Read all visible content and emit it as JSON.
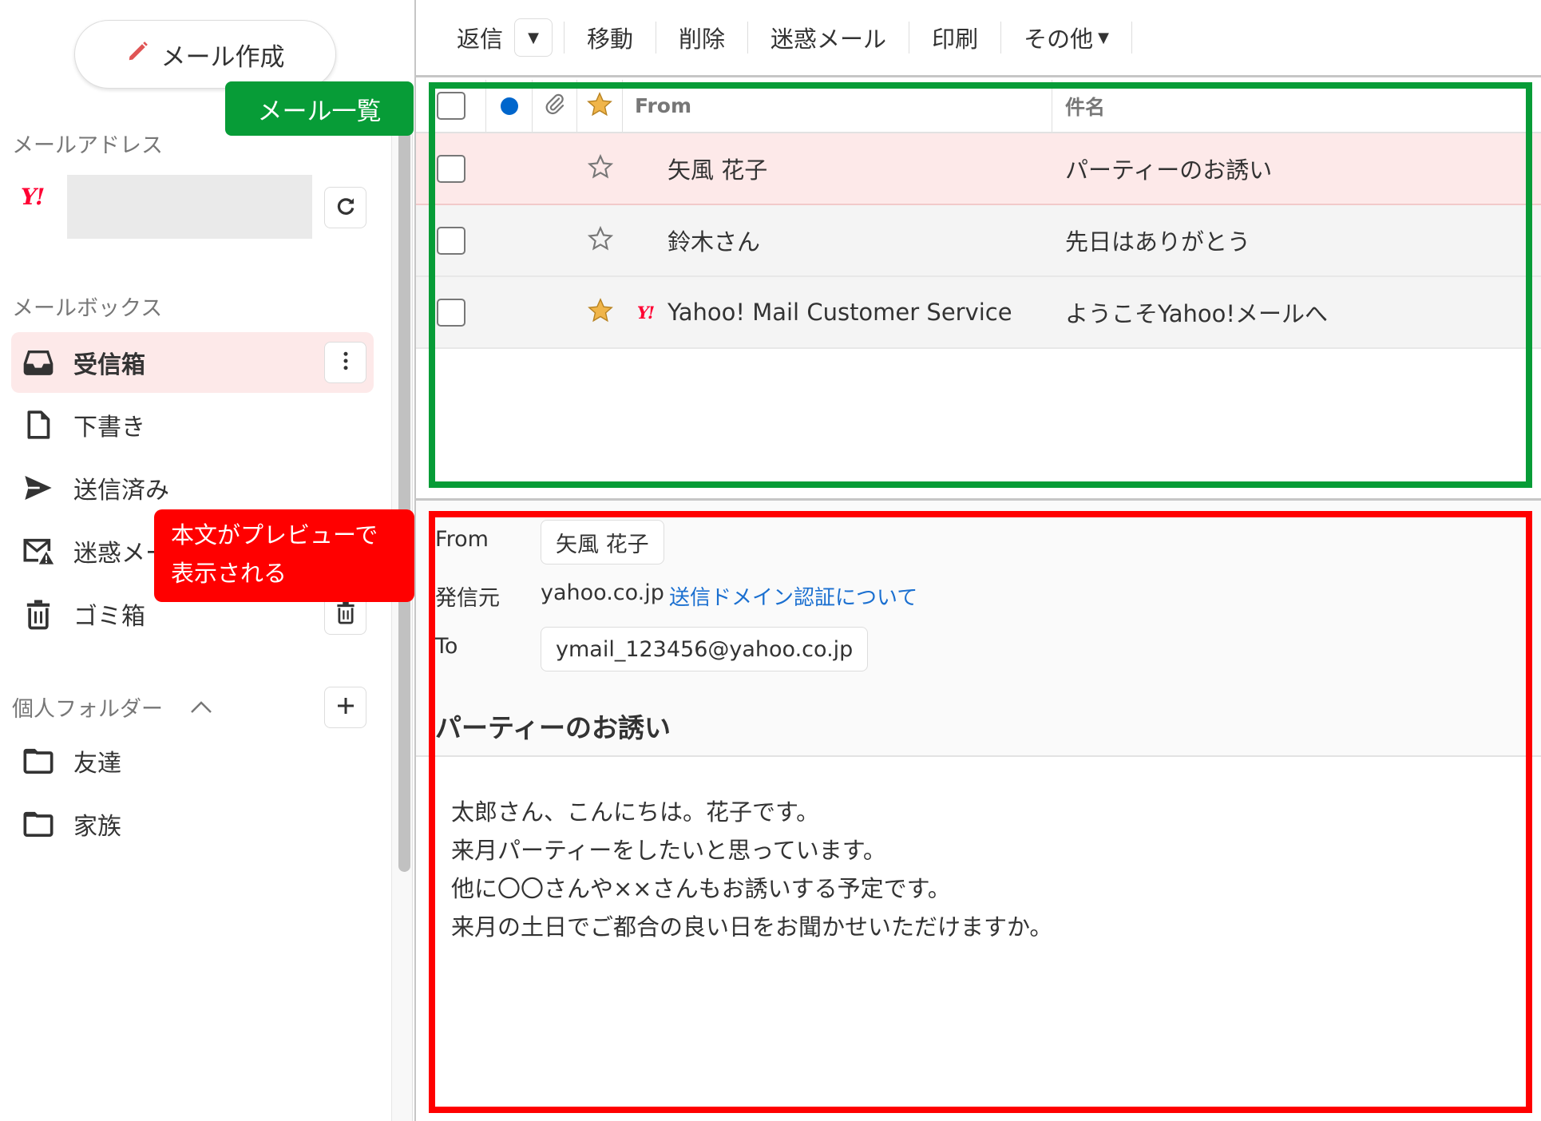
{
  "sidebar": {
    "compose_label": "メール作成",
    "address_section_label": "メールアドレス",
    "account_logo": "Y!",
    "mailbox_section_label": "メールボックス",
    "mailboxes": [
      {
        "label": "受信箱",
        "icon": "inbox-icon",
        "active": true
      },
      {
        "label": "下書き",
        "icon": "draft-icon",
        "active": false
      },
      {
        "label": "送信済み",
        "icon": "sent-icon",
        "active": false
      },
      {
        "label": "迷惑メール",
        "icon": "spam-icon",
        "active": false
      },
      {
        "label": "ゴミ箱",
        "icon": "trash-icon",
        "active": false
      }
    ],
    "personal_folders_label": "個人フォルダー",
    "folders": [
      {
        "label": "友達"
      },
      {
        "label": "家族"
      }
    ]
  },
  "toolbar": {
    "reply": "返信",
    "move": "移動",
    "delete": "削除",
    "spam": "迷惑メール",
    "print": "印刷",
    "more": "その他"
  },
  "list": {
    "headers": {
      "from": "From",
      "subject": "件名"
    },
    "rows": [
      {
        "from": "矢風 花子",
        "subject": "パーティーのお誘い",
        "starred": false,
        "yahoo": false,
        "selected": true
      },
      {
        "from": "鈴木さん",
        "subject": "先日はありがとう",
        "starred": false,
        "yahoo": false,
        "selected": false
      },
      {
        "from": "Yahoo! Mail Customer Service",
        "subject": "ようこそYahoo!メールへ",
        "starred": true,
        "yahoo": true,
        "selected": false
      }
    ]
  },
  "preview": {
    "from_label": "From",
    "from_value": "矢風 花子",
    "origin_label": "発信元",
    "origin_value": "yahoo.co.jp",
    "origin_link": "送信ドメイン認証について",
    "to_label": "To",
    "to_value": "ymail_123456@yahoo.co.jp",
    "subject": "パーティーのお誘い",
    "body_lines": [
      "太郎さん、こんにちは。花子です。",
      "来月パーティーをしたいと思っています。",
      "他に〇〇さんや××さんもお誘いする予定です。",
      "来月の土日でご都合の良い日をお聞かせいただけますか。"
    ]
  },
  "annotations": {
    "list_tag": "メール一覧",
    "preview_tag_line1": "本文がプレビューで",
    "preview_tag_line2": "表示される"
  },
  "colors": {
    "accent_red": "#ff0033",
    "selected_row": "#fde9e9",
    "annotation_green": "#079c37",
    "annotation_red": "#ff0000",
    "link_blue": "#1a6fd0",
    "unread_dot": "#0066cc",
    "star_gold": "#f0b54a"
  }
}
